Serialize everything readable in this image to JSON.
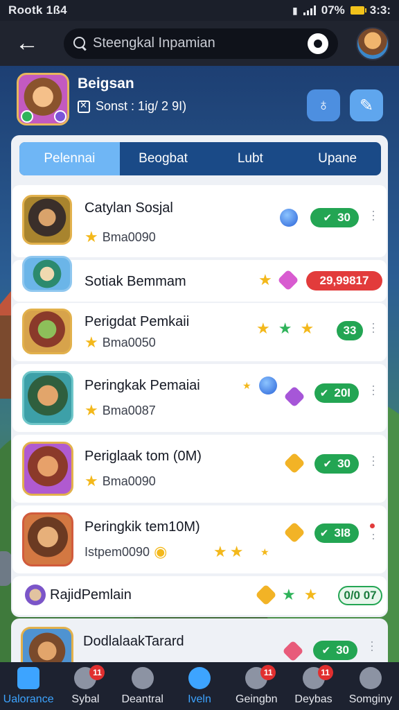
{
  "status_bar": {
    "carrier": "Rootk 1ß4",
    "battery_percent": "07%",
    "time": "3:3:"
  },
  "app_bar": {
    "back_icon": "arrow-left-icon",
    "search_placeholder": "Steengkal Inpamian",
    "settings_icon": "gear-icon"
  },
  "profile": {
    "name": "Beigsan",
    "subtitle": "Sonst : 1ig/ 2 9I)"
  },
  "tabs": [
    {
      "label": "Pelennai",
      "active": true
    },
    {
      "label": "Beogbat",
      "active": false
    },
    {
      "label": "Lubt",
      "active": false
    },
    {
      "label": "Upane",
      "active": false
    }
  ],
  "rows": [
    {
      "title": "Catylan Sosjal",
      "sub": "Bma0090",
      "pill": "30",
      "pill_color": "green"
    },
    {
      "title": "Sotiak Bemmam",
      "sub": "",
      "pill": "29,99817",
      "pill_color": "red"
    },
    {
      "title": "Perigdat Pemkaii",
      "sub": "Bma0050",
      "pill": "33",
      "pill_color": "green"
    },
    {
      "title": "Peringkak Pemaiai",
      "sub": "Bma0087",
      "pill": "20I",
      "pill_color": "green"
    },
    {
      "title": "Periglaak tom (0M)",
      "sub": "Bma0090",
      "pill": "30",
      "pill_color": "green"
    },
    {
      "title": "Peringkik tem10M)",
      "sub": "Istpem0090",
      "pill": "3I8",
      "pill_color": "green"
    },
    {
      "title": "RajidPemlain",
      "sub": "",
      "pill": "0/0 07",
      "pill_color": "green-outline"
    },
    {
      "title": "DodlalaakTarard",
      "sub": "",
      "pill": "30",
      "pill_color": "green"
    }
  ],
  "bottom_nav": [
    {
      "label": "Ualorance",
      "active": true,
      "badge": ""
    },
    {
      "label": "Sybal",
      "active": false,
      "badge": "11"
    },
    {
      "label": "Deantral",
      "active": false,
      "badge": ""
    },
    {
      "label": "Iveln",
      "active": false,
      "badge": ""
    },
    {
      "label": "Geingbn",
      "active": false,
      "badge": "11"
    },
    {
      "label": "Deybas",
      "active": false,
      "badge": "11"
    },
    {
      "label": "Somginy",
      "active": false,
      "badge": ""
    }
  ]
}
